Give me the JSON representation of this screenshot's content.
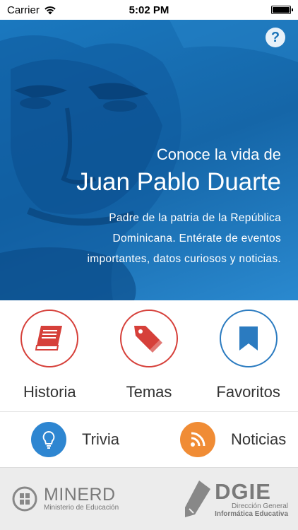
{
  "status_bar": {
    "carrier": "Carrier",
    "time": "5:02 PM"
  },
  "hero": {
    "subtitle": "Conoce la vida de",
    "title": "Juan Pablo Duarte",
    "description": "Padre de la patria de la República Dominicana. Entérate de eventos importantes, datos curiosos y noticias.",
    "help_label": "?"
  },
  "menu_primary": [
    {
      "label": "Historia",
      "icon": "book-icon",
      "color": "#d6403a"
    },
    {
      "label": "Temas",
      "icon": "tags-icon",
      "color": "#d6403a"
    },
    {
      "label": "Favoritos",
      "icon": "bookmark-icon",
      "color": "#2b7bc0"
    }
  ],
  "menu_secondary": [
    {
      "label": "Trivia",
      "icon": "lightbulb-icon",
      "color": "#2e86d1"
    },
    {
      "label": "Noticias",
      "icon": "rss-icon",
      "color": "#f08c35"
    }
  ],
  "footer": {
    "minerd": {
      "name": "MINERD",
      "subtitle": "Ministerio de Educación"
    },
    "dgie": {
      "name": "DGIE",
      "line1": "Dirección General",
      "line2": "Informática Educativa"
    }
  }
}
